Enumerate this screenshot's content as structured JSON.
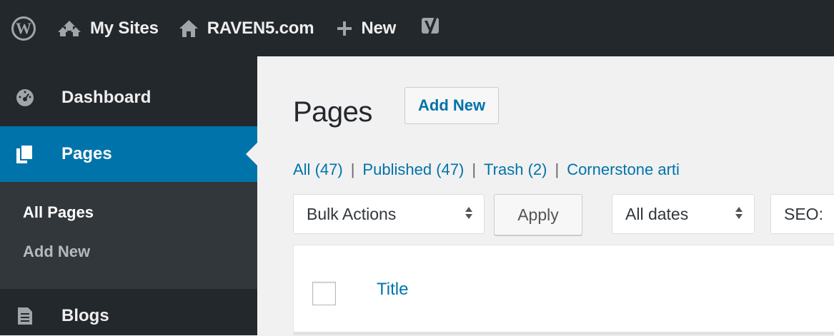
{
  "adminbar": {
    "wp_logo_glyph": "W",
    "my_sites": "My Sites",
    "site_name": "RAVEN5.com",
    "new_label": "New",
    "yoast_icon": "yoast-icon"
  },
  "sidebar": {
    "items": [
      {
        "label": "Dashboard",
        "icon": "dashboard-icon"
      },
      {
        "label": "Pages",
        "icon": "pages-icon",
        "active": true
      },
      {
        "label": "Blogs",
        "icon": "blogs-icon"
      }
    ],
    "submenu": [
      {
        "label": "All Pages",
        "current": true
      },
      {
        "label": "Add New"
      }
    ]
  },
  "main": {
    "title": "Pages",
    "add_new": "Add New",
    "filters": [
      {
        "label": "All",
        "count": "(47)"
      },
      {
        "label": "Published",
        "count": "(47)"
      },
      {
        "label": "Trash",
        "count": "(2)"
      },
      {
        "label": "Cornerstone arti"
      }
    ],
    "bulk_actions": "Bulk Actions",
    "apply": "Apply",
    "all_dates": "All dates",
    "seo_filter": "SEO:",
    "table": {
      "col_title": "Title"
    }
  },
  "colors": {
    "bar_bg": "#23282d",
    "accent": "#0073aa",
    "submenu_bg": "#32373c",
    "content_bg": "#f1f1f1"
  }
}
